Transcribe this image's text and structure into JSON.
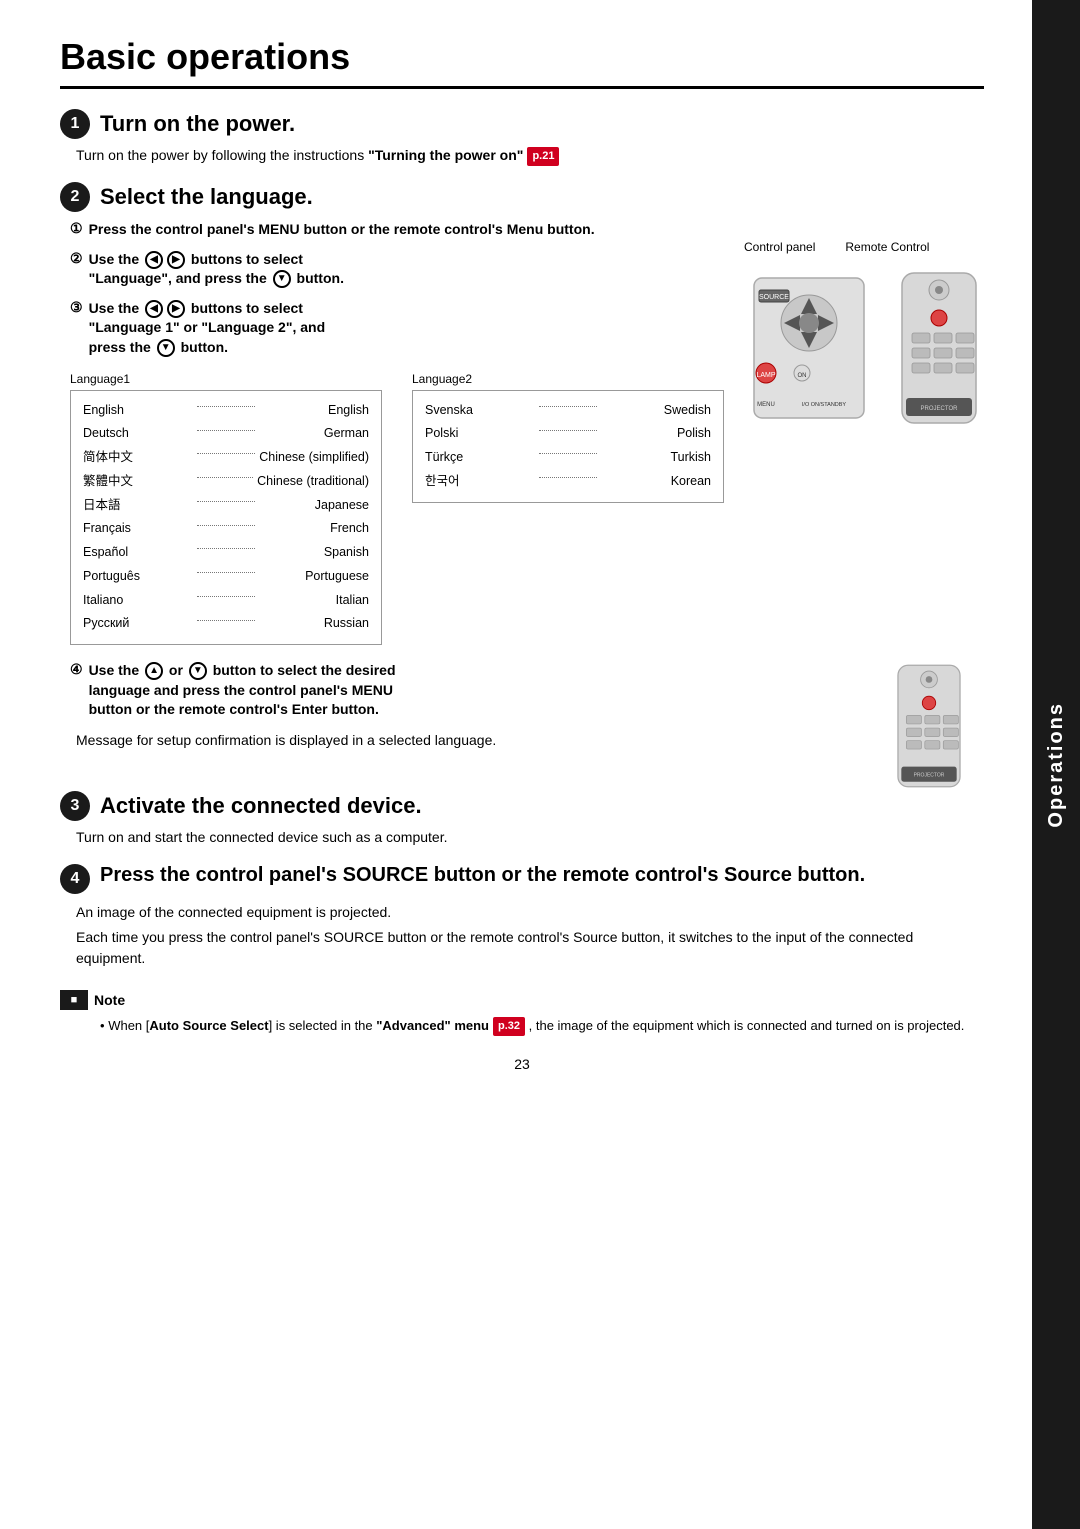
{
  "page": {
    "title": "Basic operations",
    "page_number": "23",
    "side_tab": "Operations"
  },
  "step1": {
    "number": "1",
    "heading": "Turn on the power.",
    "text": "Turn on the power by following the instructions ",
    "bold_text": "\"Turning the power on\"",
    "ref": "p.21"
  },
  "step2": {
    "number": "2",
    "heading": "Select the language.",
    "sub1_num": "①",
    "sub1_text": "Press the control panel's MENU button or the remote control's Menu button.",
    "sub2_num": "②",
    "sub2_line1": "Use the ",
    "sub2_left_arrow": "◀",
    "sub2_right_arrow": "▶",
    "sub2_line2": " buttons to select",
    "sub2_line3": "\"Language\", and press the ",
    "sub2_down_arrow": "▼",
    "sub2_line4": " button.",
    "sub3_num": "③",
    "sub3_line1": "Use the ",
    "sub3_left_arrow": "◀",
    "sub3_right_arrow": "▶",
    "sub3_line2": " buttons to select",
    "sub3_line3": "\"Language 1\" or \"Language 2\", and",
    "sub3_line4": "press the ",
    "sub3_down_arrow": "▼",
    "sub3_line5": " button.",
    "control_panel_label": "Control panel",
    "remote_control_label": "Remote Control",
    "lang1_title": "Language1",
    "lang2_title": "Language2",
    "languages1": [
      {
        "name": "English",
        "value": "English"
      },
      {
        "name": "Deutsch",
        "value": "German"
      },
      {
        "name": "简体中文",
        "value": "Chinese (simplified)"
      },
      {
        "name": "繁體中文",
        "value": "Chinese (traditional)"
      },
      {
        "name": "日本語",
        "value": "Japanese"
      },
      {
        "name": "Français",
        "value": "French"
      },
      {
        "name": "Español",
        "value": "Spanish"
      },
      {
        "name": "Português",
        "value": "Portuguese"
      },
      {
        "name": "Italiano",
        "value": "Italian"
      },
      {
        "name": "Русский",
        "value": "Russian"
      }
    ],
    "languages2": [
      {
        "name": "Svenska",
        "value": "Swedish"
      },
      {
        "name": "Polski",
        "value": "Polish"
      },
      {
        "name": "Türkçe",
        "value": "Turkish"
      },
      {
        "name": "한국어",
        "value": "Korean"
      }
    ]
  },
  "step2_sub4": {
    "num": "④",
    "line1": "Use the ",
    "up_arrow": "▲",
    "or_text": "or",
    "down_arrow": "▼",
    "line2": " button to select the desired",
    "line3": "language and press the control panel's MENU",
    "line4": "button or the remote control's Enter button.",
    "message_text": "Message for setup confirmation is displayed in a selected language."
  },
  "step3": {
    "number": "3",
    "heading": "Activate the connected device.",
    "text": "Turn on and start the connected device such as a computer."
  },
  "step4": {
    "number": "4",
    "heading": "Press the control panel's SOURCE button or the remote control's Source button.",
    "text1": "An image of the connected equipment is projected.",
    "text2": "Each time you press the control panel's SOURCE button or the remote control's Source button, it switches to the input of the connected equipment."
  },
  "note": {
    "label": "Note",
    "bullet": "•",
    "text1": "When [",
    "bold1": "Auto Source Select",
    "text2": "] is selected in the ",
    "bold2": "\"Advanced\" menu",
    "ref": "p.32",
    "text3": " , the image of the equipment which is connected and turned on is projected."
  }
}
